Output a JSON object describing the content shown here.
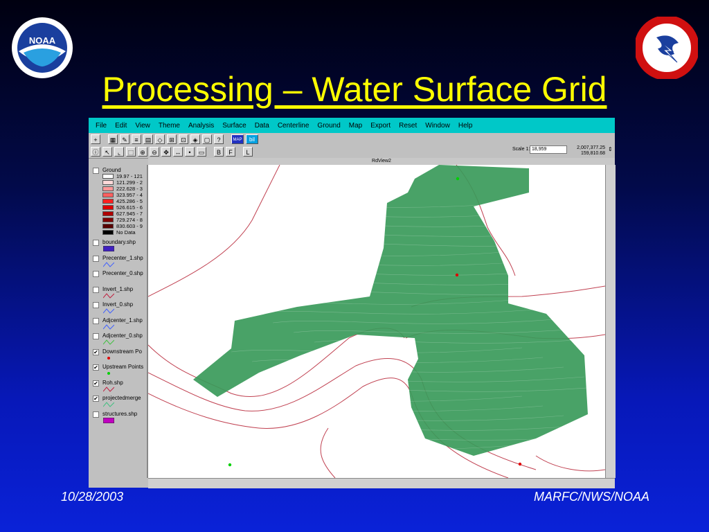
{
  "slide": {
    "title": "Processing – Water Surface Grid",
    "footer_date": "10/28/2003",
    "footer_org": "MARFC/NWS/NOAA",
    "logos": [
      "noaa-logo",
      "nws-logo"
    ]
  },
  "app": {
    "menu": [
      "File",
      "Edit",
      "View",
      "Theme",
      "Analysis",
      "Surface",
      "Data",
      "Centerline",
      "Ground",
      "Map",
      "Export",
      "Reset",
      "Window",
      "Help"
    ],
    "view_title": "RdView2",
    "toolbar_labels": {
      "map": "MAP",
      "bil": "bil",
      "b": "B",
      "f": "F",
      "l": "L"
    },
    "scale_label": "Scale 1:",
    "scale_value": "18,959",
    "coord_x": "2,007,377.25",
    "coord_y": "159,810.68"
  },
  "legend": {
    "ground": {
      "name": "Ground",
      "classes": [
        {
          "label": "19.97 - 121",
          "color": "#ffffff"
        },
        {
          "label": "121.299 - 2",
          "color": "#ffd8d8"
        },
        {
          "label": "222.628 - 3",
          "color": "#ff9898"
        },
        {
          "label": "323.957 - 4",
          "color": "#ff6060"
        },
        {
          "label": "425.286 - 5",
          "color": "#ff2020"
        },
        {
          "label": "526.615 - 6",
          "color": "#e00000"
        },
        {
          "label": "627.945 - 7",
          "color": "#b00000"
        },
        {
          "label": "729.274 - 8",
          "color": "#800000"
        },
        {
          "label": "830.603 - 9",
          "color": "#580000"
        },
        {
          "label": "No Data",
          "color": "#000000"
        }
      ]
    },
    "layers": [
      {
        "name": "boundary.shp",
        "checked": false,
        "symbol": "fill",
        "color": "#4020c0"
      },
      {
        "name": "Precenter_1.shp",
        "checked": false,
        "symbol": "line",
        "color": "#4060ff"
      },
      {
        "name": "Precenter_0.shp",
        "checked": false,
        "symbol": "none",
        "color": "#4060ff"
      },
      {
        "name": "Invert_1.shp",
        "checked": false,
        "symbol": "line",
        "color": "#c02040"
      },
      {
        "name": "Invert_0.shp",
        "checked": false,
        "symbol": "line",
        "color": "#4060ff"
      },
      {
        "name": "Adjcenter_1.shp",
        "checked": false,
        "symbol": "line",
        "color": "#4060ff"
      },
      {
        "name": "Adjcenter_0.shp",
        "checked": false,
        "symbol": "line",
        "color": "#40c040"
      },
      {
        "name": "Downstream Po",
        "checked": true,
        "symbol": "dot",
        "color": "#e00000"
      },
      {
        "name": "Upstream Points",
        "checked": true,
        "symbol": "dot",
        "color": "#00d000"
      },
      {
        "name": "Roh.shp",
        "checked": true,
        "symbol": "line",
        "color": "#c02040"
      },
      {
        "name": "projectedmerge",
        "checked": true,
        "symbol": "line",
        "color": "#40c080"
      },
      {
        "name": "structures.shp",
        "checked": false,
        "symbol": "fill",
        "color": "#c000c0"
      }
    ]
  },
  "map": {
    "grid_color": "#3a9a5a",
    "river_color": "#c04050",
    "points": [
      {
        "kind": "downstream",
        "color": "#e00000"
      },
      {
        "kind": "downstream",
        "color": "#e00000"
      },
      {
        "kind": "upstream",
        "color": "#00d000"
      },
      {
        "kind": "upstream",
        "color": "#00d000"
      }
    ]
  }
}
